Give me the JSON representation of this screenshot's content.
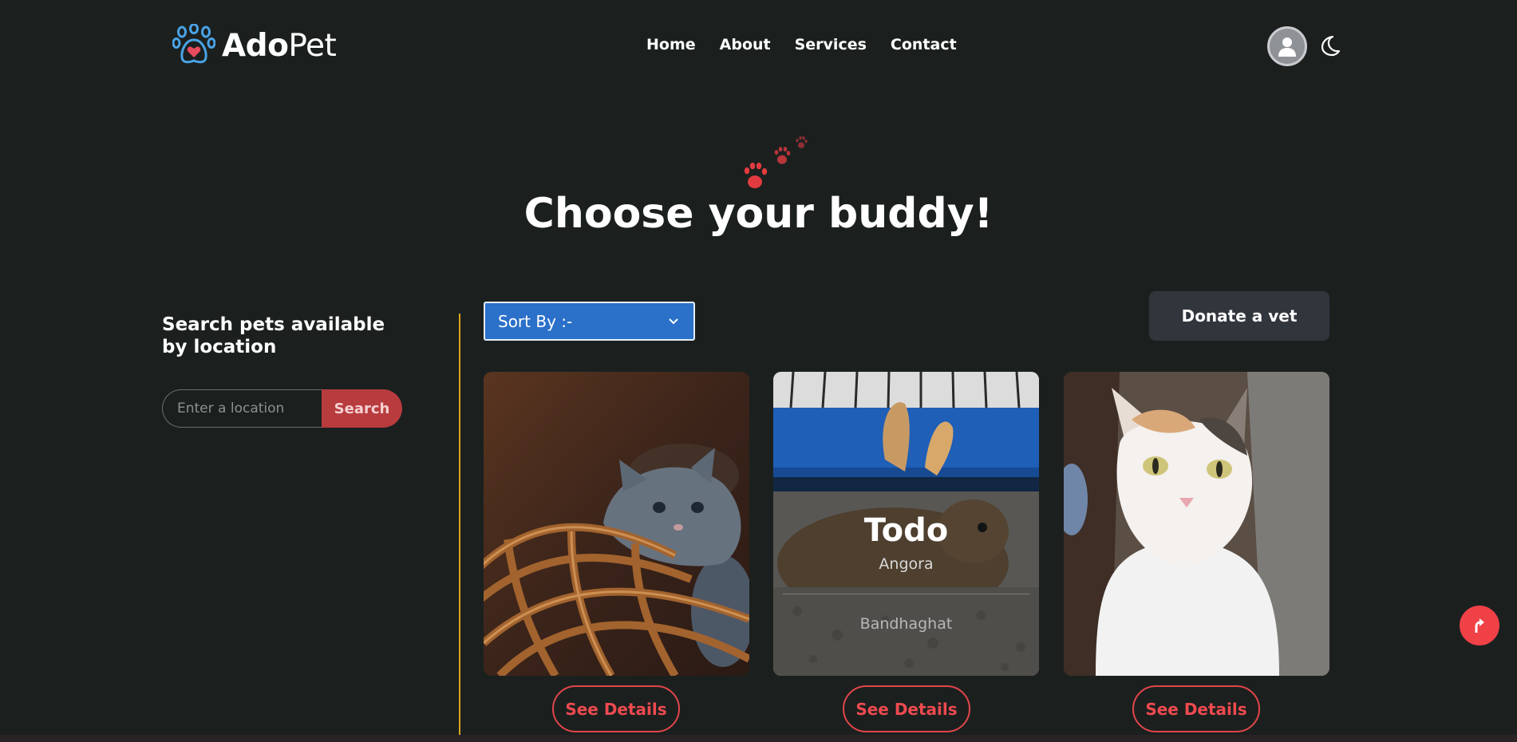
{
  "header": {
    "logo_bold": "Ado",
    "logo_light": "Pet",
    "nav": [
      "Home",
      "About",
      "Services",
      "Contact"
    ]
  },
  "hero": {
    "title": "Choose your buddy!"
  },
  "sidebar": {
    "heading": "Search pets available by location",
    "search_placeholder": "Enter a location",
    "search_button": "Search"
  },
  "toolbar": {
    "sort_label": "Sort By :-",
    "donate_label": "Donate a vet"
  },
  "cards": [
    {
      "name": "",
      "breed": "",
      "location": "",
      "button": "See Details"
    },
    {
      "name": "Todo",
      "breed": "Angora",
      "location": "Bandhaghat",
      "button": "See Details"
    },
    {
      "name": "",
      "breed": "",
      "location": "",
      "button": "See Details"
    }
  ],
  "colors": {
    "background": "#1b201f",
    "accent_red": "#ef4146",
    "sort_blue": "#2b70c9",
    "divider_gold": "#d9a520"
  },
  "icons": [
    "paw-logo-icon",
    "user-icon",
    "moon-icon",
    "paw-prints-icon",
    "chevron-down-icon",
    "arrow-up-icon"
  ]
}
